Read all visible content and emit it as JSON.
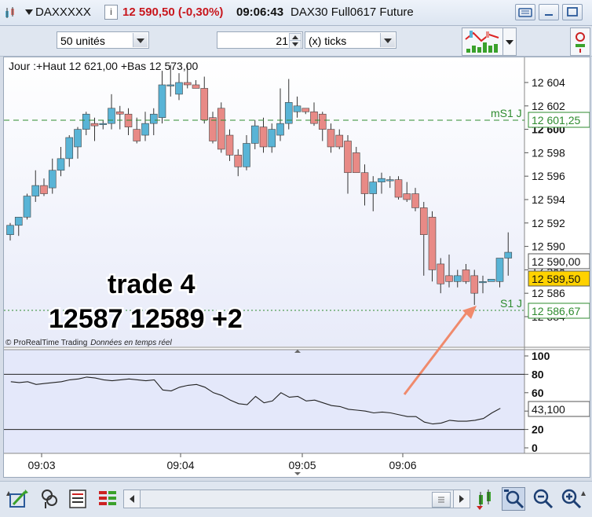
{
  "titlebar": {
    "symbol": "DAXXXXX",
    "info_icon": "i",
    "price_change": "12 590,50 (-0,30%)",
    "time": "09:06:43",
    "instrument": "DAX30 Full0617 Future"
  },
  "toolbar": {
    "quantity": "50 unités",
    "ticks_value": "21",
    "ticks_unit": "(x) ticks"
  },
  "chart": {
    "info_line": "Jour :+Haut 12 621,00 +Bas 12 573,00",
    "watermark": "© ProRealTime Trading",
    "watermark_italic": "Données en temps réel",
    "annotation_line1": "trade 4",
    "annotation_line2": "12587 12589 +2",
    "level_ms1": "mS1 J",
    "level_ms1_value": "12 601,25",
    "level_s1": "S1 J",
    "level_s1_value": "12 586,67",
    "prev_price_tag": "12 590,00",
    "last_price_tag": "12 589,50",
    "indicator_value": "43,100",
    "colors": {
      "up": "#59b4d6",
      "down": "#e88a86",
      "line_green": "#2e8b2e",
      "arrow": "#f08a6c",
      "price_tag": "#ffd200"
    }
  },
  "chart_data": {
    "type": "candlestick",
    "price_axis_ticks": [
      "12 604",
      "12 602",
      "12 600",
      "12 598",
      "12 596",
      "12 594",
      "12 592",
      "12 590",
      "12 588",
      "12 586",
      "12 584"
    ],
    "time_axis_ticks": [
      "09:03",
      "09:04",
      "09:05",
      "09:06"
    ],
    "ylim": [
      12583.5,
      12606
    ],
    "bars_ohlc": [
      [
        12591.0,
        12592.0,
        12590.5,
        12591.8
      ],
      [
        12591.8,
        12592.5,
        12590.9,
        12592.5
      ],
      [
        12592.5,
        12594.5,
        12592.3,
        12594.3
      ],
      [
        12594.3,
        12596.5,
        12593.8,
        12595.2
      ],
      [
        12595.2,
        12595.8,
        12594.3,
        12594.5
      ],
      [
        12595.0,
        12597.5,
        12594.5,
        12596.5
      ],
      [
        12596.5,
        12598.5,
        12596.0,
        12597.5
      ],
      [
        12597.5,
        12599.5,
        12596.8,
        12599.3
      ],
      [
        12598.5,
        12600.2,
        12597.5,
        12600.0
      ],
      [
        12600.0,
        12601.5,
        12599.5,
        12601.3
      ],
      [
        12600.5,
        12601.0,
        12599.0,
        12600.3
      ],
      [
        12600.5,
        12600.8,
        12600.0,
        12600.5
      ],
      [
        12600.5,
        12603.0,
        12600.0,
        12601.8
      ],
      [
        12601.5,
        12602.0,
        12600.0,
        12601.3
      ],
      [
        12601.3,
        12601.8,
        12599.5,
        12600.2
      ],
      [
        12600.0,
        12601.0,
        12598.8,
        12599.0
      ],
      [
        12599.5,
        12601.5,
        12599.0,
        12600.5
      ],
      [
        12600.5,
        12601.8,
        12599.5,
        12601.3
      ],
      [
        12601.0,
        12605.0,
        12600.5,
        12603.8
      ],
      [
        12603.8,
        12605.5,
        12602.8,
        12603.8
      ],
      [
        12603.0,
        12604.8,
        12602.5,
        12604.0
      ],
      [
        12604.0,
        12605.5,
        12603.5,
        12603.8
      ],
      [
        12603.8,
        12604.2,
        12603.5,
        12603.5
      ],
      [
        12603.5,
        12604.5,
        12600.5,
        12600.8
      ],
      [
        12601.0,
        12601.5,
        12598.8,
        12599.0
      ],
      [
        12601.8,
        12602.3,
        12598.0,
        12598.3
      ],
      [
        12599.5,
        12600.0,
        12597.3,
        12597.8
      ],
      [
        12597.8,
        12598.3,
        12596.0,
        12596.8
      ],
      [
        12596.8,
        12599.5,
        12596.5,
        12598.8
      ],
      [
        12598.8,
        12600.8,
        12598.3,
        12600.3
      ],
      [
        12600.2,
        12601.0,
        12598.0,
        12598.5
      ],
      [
        12598.5,
        12600.5,
        12598.0,
        12600.0
      ],
      [
        12599.5,
        12603.5,
        12599.0,
        12600.5
      ],
      [
        12600.5,
        12604.3,
        12600.0,
        12602.3
      ],
      [
        12601.5,
        12602.8,
        12601.0,
        12602.0
      ],
      [
        12601.8,
        12601.5,
        12601.3,
        12601.5
      ],
      [
        12601.5,
        12602.3,
        12600.3,
        12600.5
      ],
      [
        12601.3,
        12601.5,
        12599.0,
        12600.0
      ],
      [
        12600.0,
        12600.5,
        12598.0,
        12598.5
      ],
      [
        12599.5,
        12600.0,
        12598.3,
        12598.5
      ],
      [
        12599.0,
        12599.5,
        12594.5,
        12596.3
      ],
      [
        12598.0,
        12598.5,
        12596.5,
        12596.3
      ],
      [
        12596.3,
        12597.0,
        12593.5,
        12594.5
      ],
      [
        12594.5,
        12596.0,
        12593.0,
        12595.5
      ],
      [
        12595.5,
        12596.3,
        12594.5,
        12595.8
      ],
      [
        12595.6,
        12596.0,
        12595.0,
        12595.7
      ],
      [
        12595.7,
        12596.0,
        12594.0,
        12594.2
      ],
      [
        12594.5,
        12595.5,
        12593.8,
        12594.0
      ],
      [
        12594.5,
        12595.0,
        12593.0,
        12593.3
      ],
      [
        12593.3,
        12593.8,
        12587.5,
        12591.0
      ],
      [
        12592.5,
        12593.0,
        12587.0,
        12588.0
      ],
      [
        12588.5,
        12589.0,
        12586.0,
        12586.8
      ],
      [
        12587.5,
        12589.3,
        12586.5,
        12587.0
      ],
      [
        12587.0,
        12588.0,
        12586.5,
        12587.5
      ],
      [
        12588.0,
        12588.5,
        12586.8,
        12587.0
      ],
      [
        12587.5,
        12588.0,
        12585.0,
        12586.0
      ],
      [
        12587.0,
        12587.5,
        12586.0,
        12587.0
      ],
      [
        12587.0,
        12587.2,
        12587.0,
        12587.2
      ],
      [
        12587.0,
        12588.5,
        12586.5,
        12589.0
      ],
      [
        12589.0,
        12591.2,
        12587.5,
        12589.5
      ]
    ],
    "indicator": {
      "ticks": [
        "100",
        "80",
        "60",
        "40",
        "20",
        "0"
      ],
      "ylim": [
        0,
        100
      ],
      "levels": [
        80,
        20
      ],
      "values": [
        72,
        71,
        72,
        69,
        70,
        71,
        72,
        74,
        75,
        77,
        76,
        74,
        73,
        74,
        75,
        74,
        73,
        74,
        63,
        62,
        66,
        68,
        69,
        66,
        60,
        57,
        52,
        48,
        47,
        56,
        49,
        51,
        60,
        55,
        56,
        51,
        52,
        49,
        46,
        45,
        42,
        41,
        40,
        38,
        39,
        38,
        36,
        34,
        34,
        28,
        26,
        27,
        30,
        29,
        29,
        30,
        32,
        38,
        43
      ]
    }
  }
}
